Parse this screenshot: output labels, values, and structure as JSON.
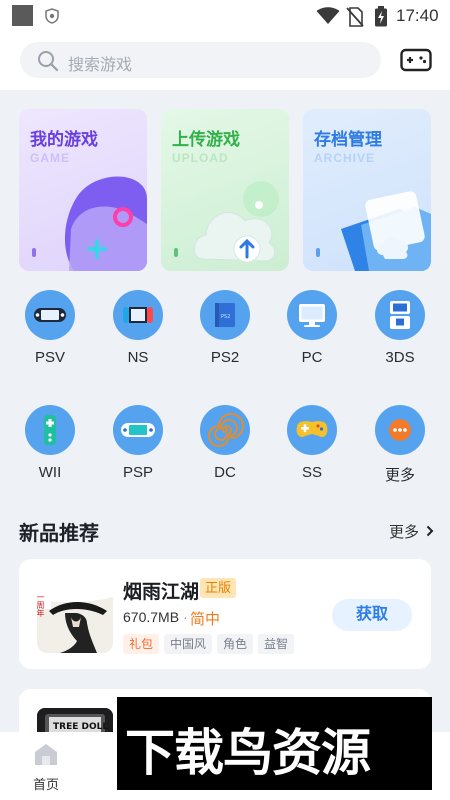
{
  "status_bar": {
    "time": "17:40",
    "icons": [
      "app-notification-icon",
      "shield-icon",
      "wifi-icon",
      "no-sim-icon",
      "battery-icon"
    ]
  },
  "search": {
    "placeholder": "搜索游戏",
    "icon": "search-icon"
  },
  "header": {
    "action_icon": "gamepad-icon"
  },
  "feature_cards": [
    {
      "title": "我的游戏",
      "subtitle": "GAME",
      "color": "#6a3fe0",
      "bg": "#e7defc"
    },
    {
      "title": "上传游戏",
      "subtitle": "UPLOAD",
      "color": "#33b049",
      "bg": "#d8f3dc"
    },
    {
      "title": "存档管理",
      "subtitle": "ARCHIVE",
      "color": "#2f7be4",
      "bg": "#d8e8fb"
    }
  ],
  "platforms": [
    {
      "label": "PSV",
      "icon": "psv-console-icon"
    },
    {
      "label": "NS",
      "icon": "switch-console-icon"
    },
    {
      "label": "PS2",
      "icon": "ps2-console-icon"
    },
    {
      "label": "PC",
      "icon": "monitor-icon"
    },
    {
      "label": "3DS",
      "icon": "3ds-console-icon"
    },
    {
      "label": "WII",
      "icon": "wii-remote-icon"
    },
    {
      "label": "PSP",
      "icon": "psp-console-icon"
    },
    {
      "label": "DC",
      "icon": "dreamcast-icon"
    },
    {
      "label": "SS",
      "icon": "saturn-controller-icon"
    },
    {
      "label": "更多",
      "icon": "more-icon"
    }
  ],
  "section": {
    "title": "新品推荐",
    "more_label": "更多"
  },
  "featured_game": {
    "name": "烟雨江湖",
    "badge": "正版",
    "size": "670.7MB",
    "separator": "·",
    "language": "简中",
    "tags": [
      "礼包",
      "中国风",
      "角色",
      "益智"
    ],
    "action_label": "获取",
    "thumb_text": "一周年"
  },
  "second_game": {
    "thumb_text": "TREE DOLL"
  },
  "bottom_nav": {
    "home_label": "首页"
  },
  "watermark": {
    "text": "下载鸟资源"
  },
  "colors": {
    "accent": "#2b7ee8",
    "platform_icon": "#55a3ef",
    "background": "#eef1f6"
  }
}
